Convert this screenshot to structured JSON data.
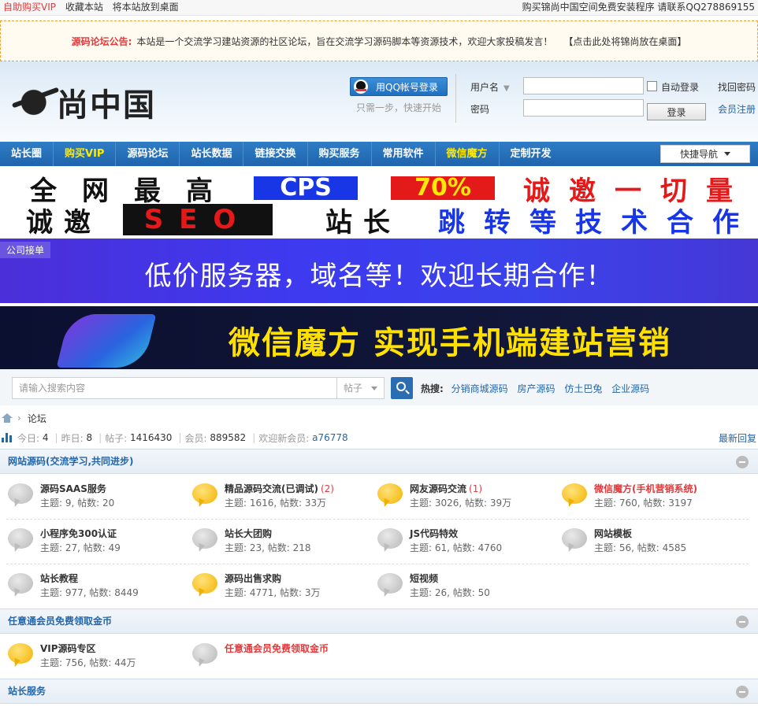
{
  "topbar": {
    "links": [
      "自助购买VIP",
      "收藏本站",
      "将本站放到桌面"
    ],
    "right_text": "购买锦尚中国空间免费安装程序 请联系QQ278869155"
  },
  "notice": {
    "title": "源码论坛公告:",
    "text": "本站是一个交流学习建站资源的社区论坛，旨在交流学习源码脚本等资源技术，欢迎大家投稿发言！",
    "extra": "【点击此处将锦尚放在桌面】"
  },
  "header": {
    "logo_text": "尚中国",
    "qq_login": "用QQ帐号登录",
    "qq_tip": "只需一步，快速开始",
    "username_label": "用户名",
    "password_label": "密码",
    "auto_login": "自动登录",
    "find_password": "找回密码",
    "login_button": "登录",
    "register": "会员注册"
  },
  "nav": {
    "items": [
      {
        "label": "站长圈",
        "hl": false
      },
      {
        "label": "购买VIP",
        "hl": true
      },
      {
        "label": "源码论坛",
        "hl": false
      },
      {
        "label": "站长数据",
        "hl": false
      },
      {
        "label": "链接交换",
        "hl": false
      },
      {
        "label": "购买服务",
        "hl": false
      },
      {
        "label": "常用软件",
        "hl": false
      },
      {
        "label": "微信魔方",
        "hl": true
      },
      {
        "label": "定制开发",
        "hl": false
      }
    ],
    "quick": "快捷导航"
  },
  "banner1": {
    "row1": [
      "全",
      "网",
      "最",
      "高",
      "CPS",
      "70%",
      "诚",
      "邀",
      "一",
      "切",
      "量"
    ],
    "row2": [
      "诚",
      "邀",
      "SEO",
      "站",
      "长",
      "跳",
      "转",
      "等",
      "技",
      "术",
      "合",
      "作"
    ]
  },
  "banner2": {
    "tag": "公司接单",
    "text": "低价服务器，域名等！欢迎长期合作！"
  },
  "banner3": {
    "text": "微信魔方 实现手机端建站营销"
  },
  "search": {
    "placeholder": "请输入搜索内容",
    "type": "帖子",
    "hot_label": "热搜:",
    "hot_links": [
      "分销商城源码",
      "房产源码",
      "仿土巴兔",
      "企业源码"
    ]
  },
  "breadcrumb": {
    "current": "论坛"
  },
  "stats": {
    "today_label": "今日:",
    "today": "4",
    "yesterday_label": "昨日:",
    "yesterday": "8",
    "posts_label": "帖子:",
    "posts": "1416430",
    "members_label": "会员:",
    "members": "889582",
    "welcome_label": "欢迎新会员:",
    "new_member": "a76778",
    "latest_reply": "最新回复"
  },
  "categories": [
    {
      "title": "网站源码(交流学习,共同进步)",
      "forums": [
        {
          "name": "源码SAAS服务",
          "count": "",
          "red": false,
          "new": false,
          "stat": "主题: 9, 帖数: 20"
        },
        {
          "name": "精品源码交流(已调试)",
          "count": "(2)",
          "red": false,
          "new": true,
          "stat": "主题: 1616, 帖数: 33万"
        },
        {
          "name": "网友源码交流",
          "count": "(1)",
          "red": false,
          "new": true,
          "stat": "主题: 3026, 帖数: 39万"
        },
        {
          "name": "微信魔方(手机营销系统)",
          "count": "",
          "red": true,
          "new": true,
          "stat": "主题: 760, 帖数: 3197"
        },
        {
          "name": "小程序免300认证",
          "count": "",
          "red": false,
          "new": false,
          "stat": "主题: 27, 帖数: 49"
        },
        {
          "name": "站长大团购",
          "count": "",
          "red": false,
          "new": false,
          "stat": "主题: 23, 帖数: 218"
        },
        {
          "name": "JS代码特效",
          "count": "",
          "red": false,
          "new": false,
          "stat": "主题: 61, 帖数: 4760"
        },
        {
          "name": "网站模板",
          "count": "",
          "red": false,
          "new": false,
          "stat": "主题: 56, 帖数: 4585"
        },
        {
          "name": "站长教程",
          "count": "",
          "red": false,
          "new": false,
          "stat": "主题: 977, 帖数: 8449"
        },
        {
          "name": "源码出售求购",
          "count": "",
          "red": false,
          "new": true,
          "stat": "主题: 4771, 帖数: 3万"
        },
        {
          "name": "短视频",
          "count": "",
          "red": false,
          "new": false,
          "stat": "主题: 26, 帖数: 50"
        }
      ]
    },
    {
      "title": "任意通会员免费领取金币",
      "forums": [
        {
          "name": "VIP源码专区",
          "count": "",
          "red": false,
          "new": true,
          "stat": "主题: 756, 帖数: 44万"
        },
        {
          "name": "任意通会员免费领取金币",
          "count": "",
          "red": true,
          "new": false,
          "stat": ""
        }
      ]
    },
    {
      "title": "站长服务",
      "forums": []
    }
  ]
}
